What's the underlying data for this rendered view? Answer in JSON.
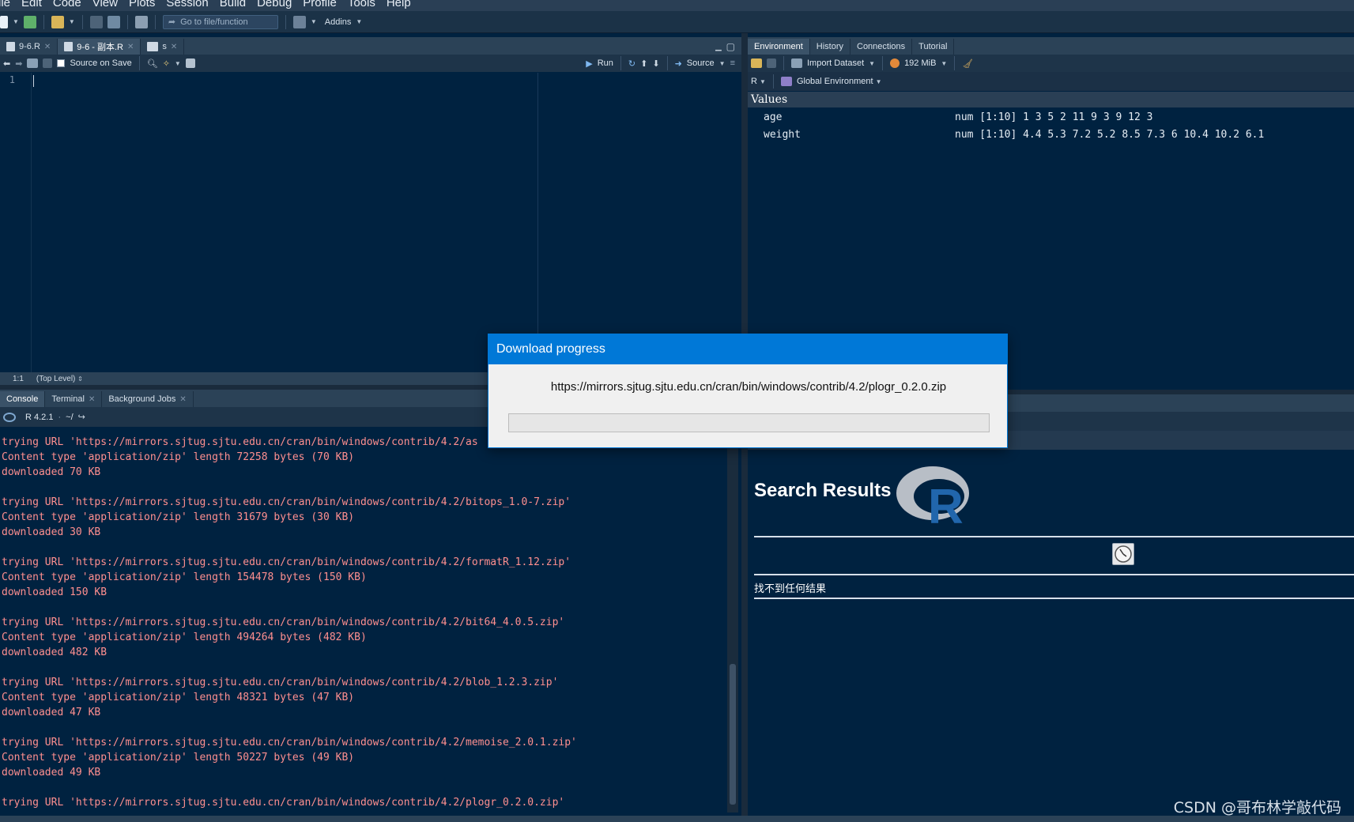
{
  "menu": [
    "ile",
    "Edit",
    "Code",
    "View",
    "Plots",
    "Session",
    "Build",
    "Debug",
    "Profile",
    "Tools",
    "Help"
  ],
  "toolbar": {
    "goto_placeholder": "Go to file/function",
    "addins_label": "Addins"
  },
  "source": {
    "tabs": [
      {
        "label": "9-6.R"
      },
      {
        "label": "9-6 - 副本.R"
      },
      {
        "label": "s"
      }
    ],
    "active_tab": 1,
    "source_on_save_label": "Source on Save",
    "run_label": "Run",
    "source_label": "Source",
    "line_number": "1",
    "cursor_pos": "1:1",
    "scope": "(Top Level)"
  },
  "console": {
    "tabs": [
      {
        "label": "Console"
      },
      {
        "label": "Terminal"
      },
      {
        "label": "Background Jobs"
      }
    ],
    "r_version": "R 4.2.1",
    "wd": "~/",
    "lines": [
      "trying URL 'https://mirrors.sjtug.sjtu.edu.cn/cran/bin/windows/contrib/4.2/as",
      "Content type 'application/zip' length 72258 bytes (70 KB)",
      "downloaded 70 KB",
      "",
      "trying URL 'https://mirrors.sjtug.sjtu.edu.cn/cran/bin/windows/contrib/4.2/bitops_1.0-7.zip'",
      "Content type 'application/zip' length 31679 bytes (30 KB)",
      "downloaded 30 KB",
      "",
      "trying URL 'https://mirrors.sjtug.sjtu.edu.cn/cran/bin/windows/contrib/4.2/formatR_1.12.zip'",
      "Content type 'application/zip' length 154478 bytes (150 KB)",
      "downloaded 150 KB",
      "",
      "trying URL 'https://mirrors.sjtug.sjtu.edu.cn/cran/bin/windows/contrib/4.2/bit64_4.0.5.zip'",
      "Content type 'application/zip' length 494264 bytes (482 KB)",
      "downloaded 482 KB",
      "",
      "trying URL 'https://mirrors.sjtug.sjtu.edu.cn/cran/bin/windows/contrib/4.2/blob_1.2.3.zip'",
      "Content type 'application/zip' length 48321 bytes (47 KB)",
      "downloaded 47 KB",
      "",
      "trying URL 'https://mirrors.sjtug.sjtu.edu.cn/cran/bin/windows/contrib/4.2/memoise_2.0.1.zip'",
      "Content type 'application/zip' length 50227 bytes (49 KB)",
      "downloaded 49 KB",
      "",
      "trying URL 'https://mirrors.sjtug.sjtu.edu.cn/cran/bin/windows/contrib/4.2/plogr_0.2.0.zip'"
    ]
  },
  "environment": {
    "tabs": [
      {
        "label": "Environment"
      },
      {
        "label": "History"
      },
      {
        "label": "Connections"
      },
      {
        "label": "Tutorial"
      }
    ],
    "import_label": "Import Dataset",
    "memory": "192 MiB",
    "lang": "R",
    "scope": "Global Environment",
    "section": "Values",
    "vars": [
      {
        "name": "age",
        "value": "num [1:10] 1 3 5 2 11 9 3 9 12 3"
      },
      {
        "name": "weight",
        "value": "num [1:10] 4.4 5.3 7.2 5.2 8.5 7.3 6 10.4 10.2 6.1"
      }
    ]
  },
  "help": {
    "title": "Search Results",
    "no_results": "找不到任何结果"
  },
  "dialog": {
    "title": "Download progress",
    "url": "https://mirrors.sjtug.sjtu.edu.cn/cran/bin/windows/contrib/4.2/plogr_0.2.0.zip",
    "progress": 0
  },
  "watermark": "CSDN @哥布林学敲代码",
  "colors": {
    "accent": "#0078d7",
    "console_text": "#ff8f8f",
    "background": "#002240"
  }
}
